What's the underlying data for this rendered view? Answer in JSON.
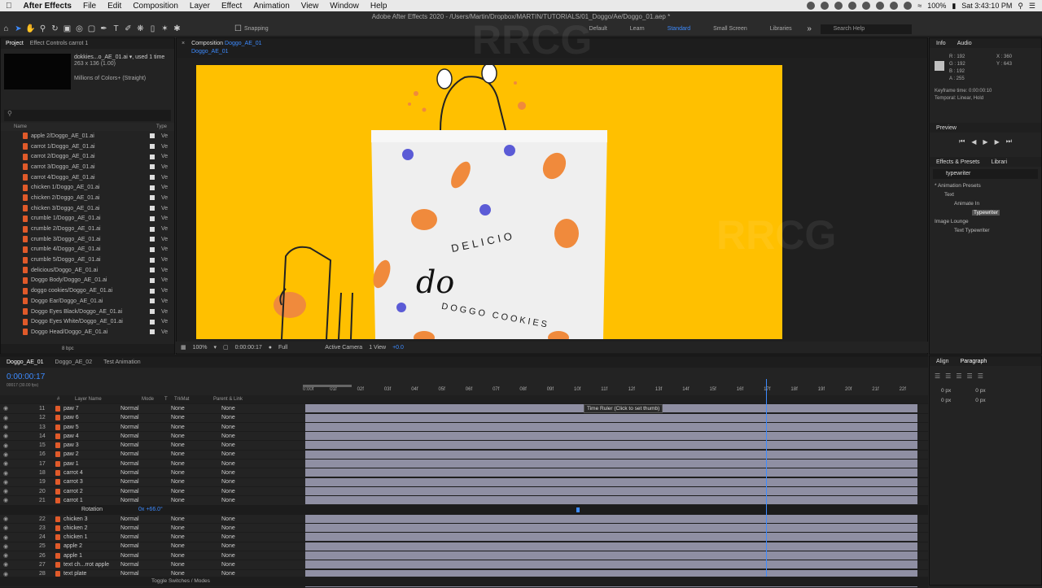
{
  "menubar": {
    "app": "After Effects",
    "items": [
      "File",
      "Edit",
      "Composition",
      "Layer",
      "Effect",
      "Animation",
      "View",
      "Window",
      "Help"
    ],
    "battery": "100%",
    "clock": "Sat 3:43:10 PM"
  },
  "titlebar": {
    "text": "Adobe After Effects 2020 - /Users/Martin/Dropbox/MARTIN/TUTORIALS/01_Doggo/Ae/Doggo_01.aep *"
  },
  "toolbar": {
    "snapping": "Snapping",
    "workspaces": [
      "Default",
      "Learn",
      "Standard",
      "Small Screen",
      "Libraries"
    ],
    "active_workspace": "Standard",
    "search_help": "Search Help"
  },
  "project": {
    "tab": "Project",
    "tab2": "Effect Controls carrot 1",
    "thumb_name": "dokkies...o_AE_01.ai ▾",
    "thumb_used": ", used 1 time",
    "thumb_dims": "263 x 136 (1.00)",
    "thumb_colors": "Millions of Colors+ (Straight)",
    "col_name": "Name",
    "col_type": "Type",
    "items": [
      {
        "name": "apple 2/Doggo_AE_01.ai",
        "type": "Ve"
      },
      {
        "name": "carrot 1/Doggo_AE_01.ai",
        "type": "Ve"
      },
      {
        "name": "carrot 2/Doggo_AE_01.ai",
        "type": "Ve"
      },
      {
        "name": "carrot 3/Doggo_AE_01.ai",
        "type": "Ve"
      },
      {
        "name": "carrot 4/Doggo_AE_01.ai",
        "type": "Ve"
      },
      {
        "name": "chicken 1/Doggo_AE_01.ai",
        "type": "Ve"
      },
      {
        "name": "chicken 2/Doggo_AE_01.ai",
        "type": "Ve"
      },
      {
        "name": "chicken 3/Doggo_AE_01.ai",
        "type": "Ve"
      },
      {
        "name": "crumble 1/Doggo_AE_01.ai",
        "type": "Ve"
      },
      {
        "name": "crumble 2/Doggo_AE_01.ai",
        "type": "Ve"
      },
      {
        "name": "crumble 3/Doggo_AE_01.ai",
        "type": "Ve"
      },
      {
        "name": "crumble 4/Doggo_AE_01.ai",
        "type": "Ve"
      },
      {
        "name": "crumble 5/Doggo_AE_01.ai",
        "type": "Ve"
      },
      {
        "name": "delicious/Doggo_AE_01.ai",
        "type": "Ve"
      },
      {
        "name": "Doggo Body/Doggo_AE_01.ai",
        "type": "Ve"
      },
      {
        "name": "doggo cookies/Doggo_AE_01.ai",
        "type": "Ve"
      },
      {
        "name": "Doggo Ear/Doggo_AE_01.ai",
        "type": "Ve"
      },
      {
        "name": "Doggo Eyes Black/Doggo_AE_01.ai",
        "type": "Ve"
      },
      {
        "name": "Doggo Eyes White/Doggo_AE_01.ai",
        "type": "Ve"
      },
      {
        "name": "Doggo Head/Doggo_AE_01.ai",
        "type": "Ve"
      }
    ],
    "bpc": "8 bpc"
  },
  "composition": {
    "tab": "Composition",
    "tab_name": "Doggo_AE_01",
    "breadcrumb": "Doggo_AE_01",
    "artwork": {
      "top_text": "DELICIO",
      "logo": "do",
      "bottom_text": "DOGGO COOKIES"
    },
    "viewer": {
      "zoom": "100%",
      "timecode": "0:00:00:17",
      "resolution": "Full",
      "camera": "Active Camera",
      "views": "1 View",
      "exposure": "+0.0"
    }
  },
  "info": {
    "tab": "Info",
    "tab2": "Audio",
    "r": "R : 192",
    "g": "G : 192",
    "b": "B : 192",
    "a": "A : 255",
    "x": "X : 360",
    "y": "Y : 643",
    "keyframe_time": "Keyframe time: 0:00:00:10",
    "temporal": "Temporal: Linear, Hold"
  },
  "preview": {
    "title": "Preview"
  },
  "effects": {
    "tab": "Effects & Presets",
    "tab2": "Librari",
    "search": "typewriter",
    "tree": [
      "* Animation Presets",
      "Text",
      "Animate In",
      "Typewriter",
      "Image Lounge",
      "Text Typewriter"
    ]
  },
  "timeline": {
    "tabs": [
      "Doggo_AE_01",
      "Doggo_AE_02",
      "Test Animation"
    ],
    "timecode": "0:00:00:17",
    "sub": "00017 (30.00 fps)",
    "headers": {
      "num": "#",
      "layer": "Layer Name",
      "mode": "Mode",
      "t": "T",
      "trkmat": "TrkMat",
      "parent": "Parent & Link"
    },
    "ruler": [
      "0:00f",
      "01f",
      "02f",
      "03f",
      "04f",
      "05f",
      "06f",
      "07f",
      "08f",
      "09f",
      "10f",
      "11f",
      "12f",
      "13f",
      "14f",
      "15f",
      "16f",
      "17f",
      "18f",
      "19f",
      "20f",
      "21f",
      "22f"
    ],
    "layers": [
      {
        "n": "11",
        "name": "paw 7"
      },
      {
        "n": "12",
        "name": "paw 6"
      },
      {
        "n": "13",
        "name": "paw 5"
      },
      {
        "n": "14",
        "name": "paw 4"
      },
      {
        "n": "15",
        "name": "paw 3"
      },
      {
        "n": "16",
        "name": "paw 2"
      },
      {
        "n": "17",
        "name": "paw 1"
      },
      {
        "n": "18",
        "name": "carrot 4"
      },
      {
        "n": "19",
        "name": "carrot 3"
      },
      {
        "n": "20",
        "name": "carrot 2"
      },
      {
        "n": "21",
        "name": "carrot 1"
      },
      {
        "n": "",
        "name": "Rotation"
      },
      {
        "n": "22",
        "name": "chicken 3"
      },
      {
        "n": "23",
        "name": "chicken 2"
      },
      {
        "n": "24",
        "name": "chicken 1"
      },
      {
        "n": "25",
        "name": "apple 2"
      },
      {
        "n": "26",
        "name": "apple 1"
      },
      {
        "n": "27",
        "name": "text ch...rrot apple"
      },
      {
        "n": "28",
        "name": "text plate"
      },
      {
        "n": "29",
        "name": "100 digital"
      }
    ],
    "mode": "Normal",
    "none": "None",
    "rotation_value": "0x +66.0°",
    "tooltip": "Time Ruler (Click to set thumb)",
    "toggle": "Toggle Switches / Modes"
  },
  "paragraph": {
    "tab": "Align",
    "tab2": "Paragraph",
    "vals": [
      "0 px",
      "0 px",
      "0 px",
      "0 px",
      "0 px"
    ]
  }
}
